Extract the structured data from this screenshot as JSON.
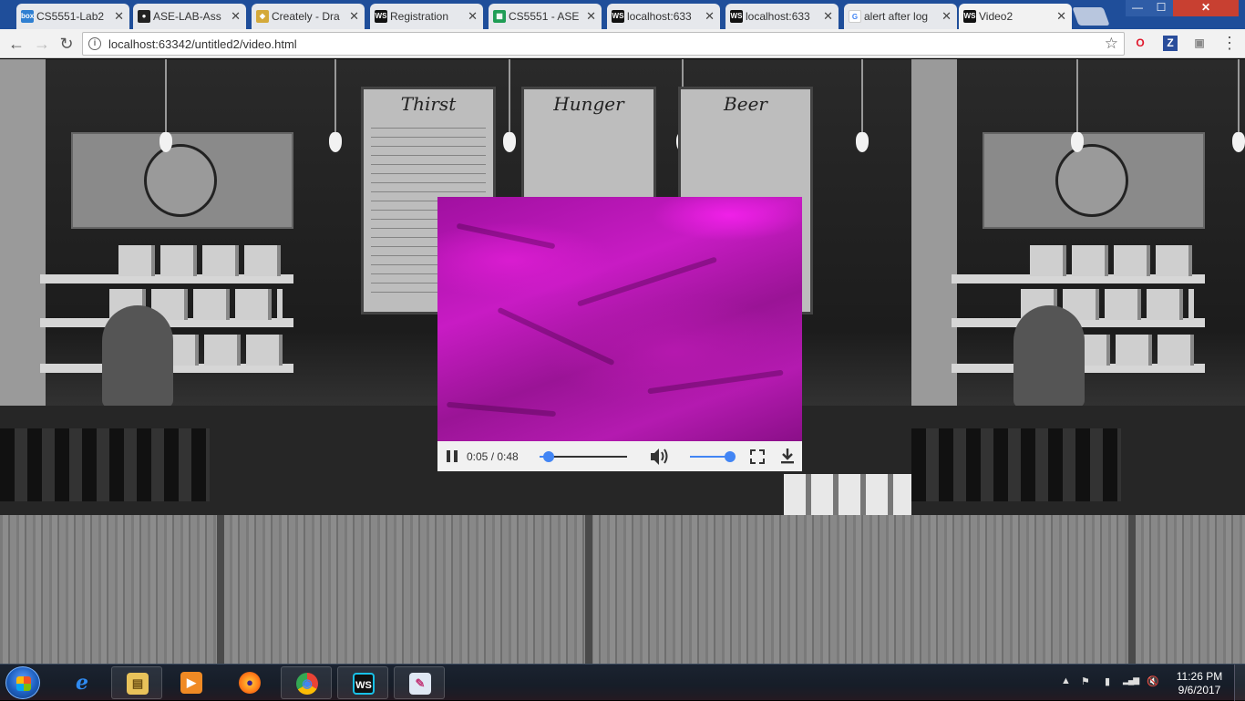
{
  "browser": {
    "tabs": [
      {
        "label": "CS5551-Lab2",
        "favicon": "box-icon",
        "fav_text": "box",
        "fav_color": "#2f7fd1",
        "active": false
      },
      {
        "label": "ASE-LAB-Ass",
        "favicon": "github-icon",
        "fav_text": "●",
        "fav_color": "#222222",
        "active": false
      },
      {
        "label": "Creately - Dra",
        "favicon": "creately-icon",
        "fav_text": "◆",
        "fav_color": "#d4a93a",
        "active": false
      },
      {
        "label": "Registration",
        "favicon": "webstorm-icon",
        "fav_text": "WS",
        "fav_color": "#111111",
        "active": false
      },
      {
        "label": "CS5551 - ASE",
        "favicon": "sheets-icon",
        "fav_text": "▦",
        "fav_color": "#1f9d55",
        "active": false
      },
      {
        "label": "localhost:633",
        "favicon": "webstorm-icon",
        "fav_text": "WS",
        "fav_color": "#111111",
        "active": false
      },
      {
        "label": "localhost:633",
        "favicon": "webstorm-icon",
        "fav_text": "WS",
        "fav_color": "#111111",
        "active": false
      },
      {
        "label": "alert after log",
        "favicon": "google-icon",
        "fav_text": "G",
        "fav_color": "#4285f4",
        "active": false
      },
      {
        "label": "Video2",
        "favicon": "webstorm-icon",
        "fav_text": "WS",
        "fav_color": "#111111",
        "active": true
      }
    ],
    "tab_close_glyph": "✕",
    "window_controls": {
      "minimize": "—",
      "maximize": "☐",
      "close": "✕"
    },
    "nav": {
      "back": "←",
      "forward": "→",
      "reload": "↻"
    },
    "address": {
      "info_glyph": "i",
      "url": "localhost:63342/untitled2/video.html",
      "star": "☆"
    },
    "extensions": [
      {
        "name": "opera-icon",
        "glyph": "O",
        "color": "#e0172b"
      },
      {
        "name": "zotero-icon",
        "glyph": "Z",
        "color": "#2a4d9b"
      },
      {
        "name": "extension-icon",
        "glyph": "▣",
        "color": "#8a8a8a"
      }
    ],
    "menu_glyph": "⋮"
  },
  "background": {
    "menu_boards": [
      "Thirst",
      "Hunger",
      "Beer"
    ],
    "colors": {
      "grayscale": "#2a2a2a"
    }
  },
  "video": {
    "current_time": "0:05",
    "duration": "0:48",
    "time_separator": " / ",
    "progress_fraction": 0.104,
    "volume_fraction": 1.0,
    "volume_glyph": "🔊",
    "fullscreen_glyph": "⛶",
    "download_glyph": "⬇",
    "frame_color": "#c81bc4",
    "accent": "#4285f4"
  },
  "taskbar": {
    "apps": [
      {
        "name": "ie-icon",
        "glyph": "e",
        "color": "#1e88e5",
        "pinned": false
      },
      {
        "name": "explorer-icon",
        "glyph": "▤",
        "color": "#e8c25a",
        "pinned": true
      },
      {
        "name": "media-player-icon",
        "glyph": "▶",
        "color": "#f08a24",
        "pinned": false
      },
      {
        "name": "firefox-icon",
        "glyph": "●",
        "color": "#ff7a18",
        "pinned": false
      },
      {
        "name": "chrome-icon",
        "glyph": "◉",
        "color": "#34a853",
        "pinned": true
      },
      {
        "name": "webstorm-icon",
        "glyph": "WS",
        "color": "#111111",
        "pinned": true
      },
      {
        "name": "paint-icon",
        "glyph": "✎",
        "color": "#5aa0e0",
        "pinned": true
      }
    ],
    "tray_glyphs": [
      "▲",
      "⚑",
      "▮",
      "▂▄▆",
      "🔇"
    ],
    "clock_time": "11:26 PM",
    "clock_date": "9/6/2017"
  }
}
